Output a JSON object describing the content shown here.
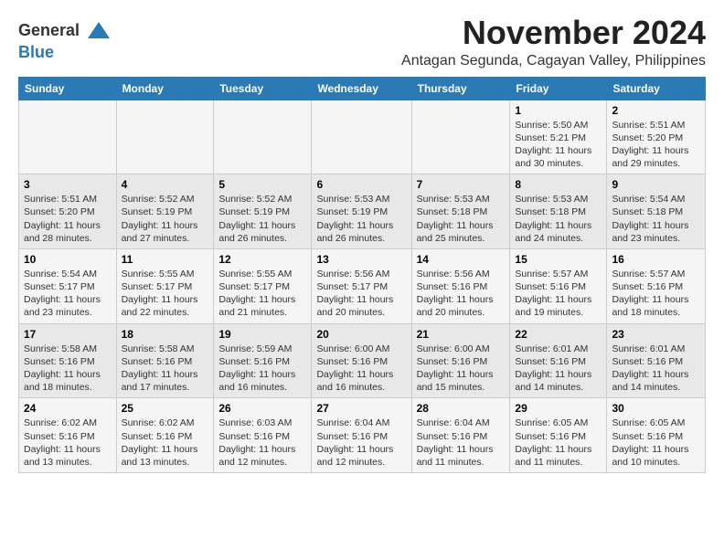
{
  "header": {
    "logo_line1": "General",
    "logo_line2": "Blue",
    "month": "November 2024",
    "location": "Antagan Segunda, Cagayan Valley, Philippines"
  },
  "weekdays": [
    "Sunday",
    "Monday",
    "Tuesday",
    "Wednesday",
    "Thursday",
    "Friday",
    "Saturday"
  ],
  "weeks": [
    [
      {
        "day": "",
        "info": ""
      },
      {
        "day": "",
        "info": ""
      },
      {
        "day": "",
        "info": ""
      },
      {
        "day": "",
        "info": ""
      },
      {
        "day": "",
        "info": ""
      },
      {
        "day": "1",
        "info": "Sunrise: 5:50 AM\nSunset: 5:21 PM\nDaylight: 11 hours\nand 30 minutes."
      },
      {
        "day": "2",
        "info": "Sunrise: 5:51 AM\nSunset: 5:20 PM\nDaylight: 11 hours\nand 29 minutes."
      }
    ],
    [
      {
        "day": "3",
        "info": "Sunrise: 5:51 AM\nSunset: 5:20 PM\nDaylight: 11 hours\nand 28 minutes."
      },
      {
        "day": "4",
        "info": "Sunrise: 5:52 AM\nSunset: 5:19 PM\nDaylight: 11 hours\nand 27 minutes."
      },
      {
        "day": "5",
        "info": "Sunrise: 5:52 AM\nSunset: 5:19 PM\nDaylight: 11 hours\nand 26 minutes."
      },
      {
        "day": "6",
        "info": "Sunrise: 5:53 AM\nSunset: 5:19 PM\nDaylight: 11 hours\nand 26 minutes."
      },
      {
        "day": "7",
        "info": "Sunrise: 5:53 AM\nSunset: 5:18 PM\nDaylight: 11 hours\nand 25 minutes."
      },
      {
        "day": "8",
        "info": "Sunrise: 5:53 AM\nSunset: 5:18 PM\nDaylight: 11 hours\nand 24 minutes."
      },
      {
        "day": "9",
        "info": "Sunrise: 5:54 AM\nSunset: 5:18 PM\nDaylight: 11 hours\nand 23 minutes."
      }
    ],
    [
      {
        "day": "10",
        "info": "Sunrise: 5:54 AM\nSunset: 5:17 PM\nDaylight: 11 hours\nand 23 minutes."
      },
      {
        "day": "11",
        "info": "Sunrise: 5:55 AM\nSunset: 5:17 PM\nDaylight: 11 hours\nand 22 minutes."
      },
      {
        "day": "12",
        "info": "Sunrise: 5:55 AM\nSunset: 5:17 PM\nDaylight: 11 hours\nand 21 minutes."
      },
      {
        "day": "13",
        "info": "Sunrise: 5:56 AM\nSunset: 5:17 PM\nDaylight: 11 hours\nand 20 minutes."
      },
      {
        "day": "14",
        "info": "Sunrise: 5:56 AM\nSunset: 5:16 PM\nDaylight: 11 hours\nand 20 minutes."
      },
      {
        "day": "15",
        "info": "Sunrise: 5:57 AM\nSunset: 5:16 PM\nDaylight: 11 hours\nand 19 minutes."
      },
      {
        "day": "16",
        "info": "Sunrise: 5:57 AM\nSunset: 5:16 PM\nDaylight: 11 hours\nand 18 minutes."
      }
    ],
    [
      {
        "day": "17",
        "info": "Sunrise: 5:58 AM\nSunset: 5:16 PM\nDaylight: 11 hours\nand 18 minutes."
      },
      {
        "day": "18",
        "info": "Sunrise: 5:58 AM\nSunset: 5:16 PM\nDaylight: 11 hours\nand 17 minutes."
      },
      {
        "day": "19",
        "info": "Sunrise: 5:59 AM\nSunset: 5:16 PM\nDaylight: 11 hours\nand 16 minutes."
      },
      {
        "day": "20",
        "info": "Sunrise: 6:00 AM\nSunset: 5:16 PM\nDaylight: 11 hours\nand 16 minutes."
      },
      {
        "day": "21",
        "info": "Sunrise: 6:00 AM\nSunset: 5:16 PM\nDaylight: 11 hours\nand 15 minutes."
      },
      {
        "day": "22",
        "info": "Sunrise: 6:01 AM\nSunset: 5:16 PM\nDaylight: 11 hours\nand 14 minutes."
      },
      {
        "day": "23",
        "info": "Sunrise: 6:01 AM\nSunset: 5:16 PM\nDaylight: 11 hours\nand 14 minutes."
      }
    ],
    [
      {
        "day": "24",
        "info": "Sunrise: 6:02 AM\nSunset: 5:16 PM\nDaylight: 11 hours\nand 13 minutes."
      },
      {
        "day": "25",
        "info": "Sunrise: 6:02 AM\nSunset: 5:16 PM\nDaylight: 11 hours\nand 13 minutes."
      },
      {
        "day": "26",
        "info": "Sunrise: 6:03 AM\nSunset: 5:16 PM\nDaylight: 11 hours\nand 12 minutes."
      },
      {
        "day": "27",
        "info": "Sunrise: 6:04 AM\nSunset: 5:16 PM\nDaylight: 11 hours\nand 12 minutes."
      },
      {
        "day": "28",
        "info": "Sunrise: 6:04 AM\nSunset: 5:16 PM\nDaylight: 11 hours\nand 11 minutes."
      },
      {
        "day": "29",
        "info": "Sunrise: 6:05 AM\nSunset: 5:16 PM\nDaylight: 11 hours\nand 11 minutes."
      },
      {
        "day": "30",
        "info": "Sunrise: 6:05 AM\nSunset: 5:16 PM\nDaylight: 11 hours\nand 10 minutes."
      }
    ]
  ]
}
